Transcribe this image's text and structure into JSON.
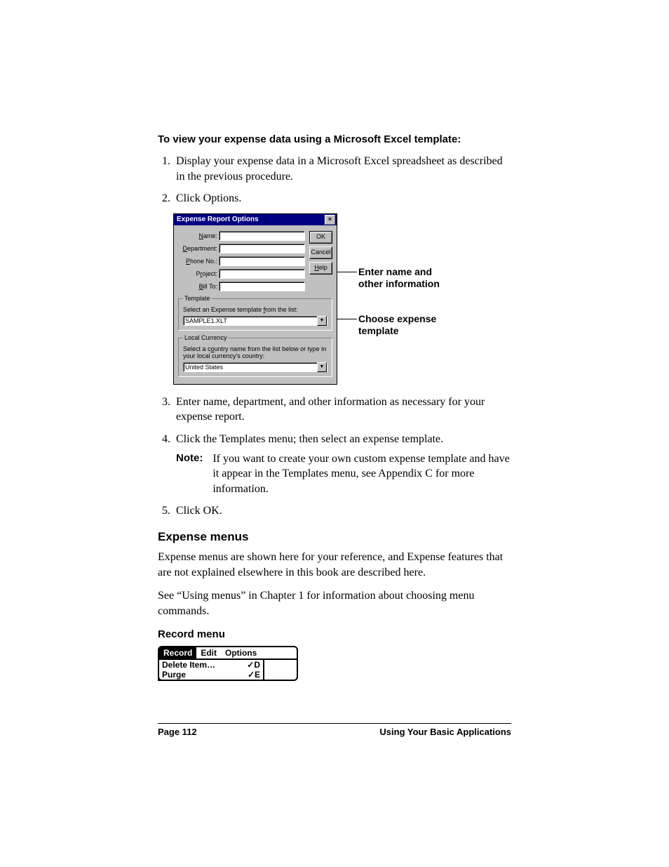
{
  "headings": {
    "procedure_title": "To view your expense data using a Microsoft Excel template:",
    "expense_menus": "Expense menus",
    "record_menu": "Record menu"
  },
  "steps": {
    "s1": "Display your expense data in a Microsoft Excel spreadsheet as described in the previous procedure.",
    "s2": "Click Options.",
    "s3": "Enter name, department, and other information as necessary for your expense report.",
    "s4": "Click the Templates menu; then select an expense template.",
    "s5": "Click OK."
  },
  "note": {
    "label": "Note:",
    "text": "If you want to create your own custom expense template and have it appear in the Templates menu, see Appendix C for more information."
  },
  "paragraphs": {
    "p1": "Expense menus are shown here for your reference, and Expense features that are not explained elsewhere in this book are described here.",
    "p2": "See “Using menus” in Chapter 1 for information about choosing menu commands."
  },
  "dialog": {
    "title": "Expense Report Options",
    "labels": {
      "name": "Name:",
      "department": "Department:",
      "phone": "Phone No.:",
      "project": "Project:",
      "billto": "Bill To:"
    },
    "buttons": {
      "ok": "OK",
      "cancel": "Cancel",
      "help": "Help"
    },
    "template_group": {
      "legend": "Template",
      "instruction": "Select an Expense template from the list:",
      "value": "SAMPLE1.XLT"
    },
    "currency_group": {
      "legend": "Local Currency",
      "instruction": "Select a country name from the list below or type in your local currency's country:",
      "value": "United States"
    }
  },
  "callouts": {
    "c1a": "Enter name and",
    "c1b": "other information",
    "c2a": "Choose expense",
    "c2b": "template"
  },
  "palm": {
    "tabs": {
      "record": "Record",
      "edit": "Edit",
      "options": "Options"
    },
    "items": {
      "delete": {
        "label": "Delete Item…",
        "shortcut": "✓D"
      },
      "purge": {
        "label": "Purge",
        "shortcut": "✓E"
      }
    }
  },
  "footer": {
    "left": "Page 112",
    "right": "Using Your Basic Applications"
  }
}
